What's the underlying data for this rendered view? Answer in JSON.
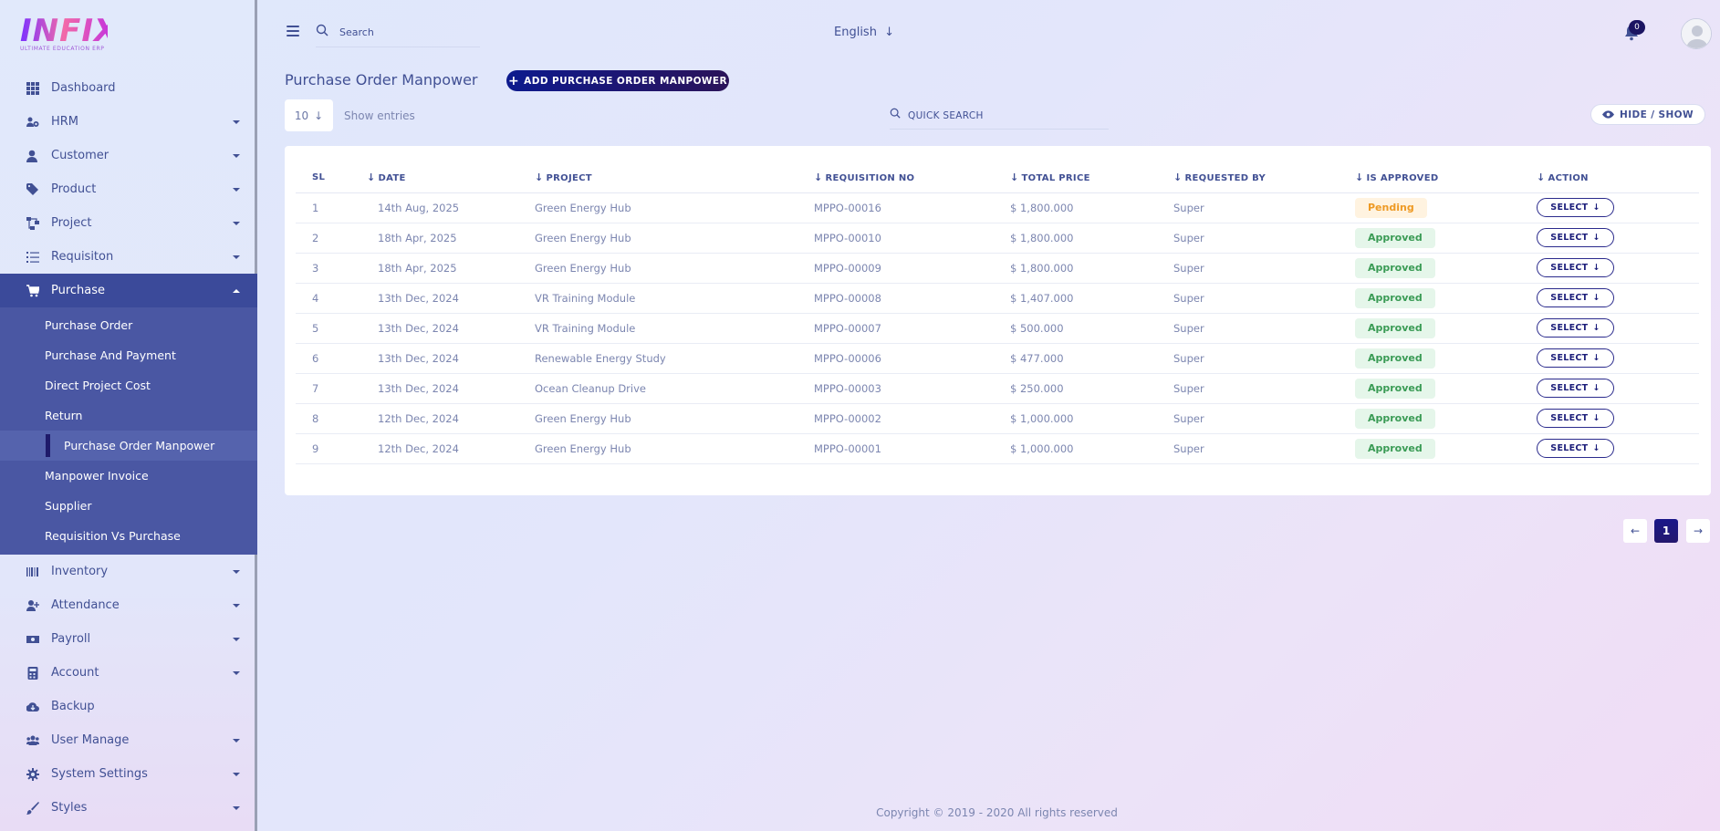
{
  "brand": {
    "logo_text": "INFIX",
    "logo_sub": "ULTIMATE EDUCATION ERP"
  },
  "sidebar": {
    "items": [
      {
        "label": "Dashboard",
        "icon": "dashboard-icon"
      },
      {
        "label": "HRM",
        "icon": "users-cog-icon"
      },
      {
        "label": "Customer",
        "icon": "user-icon"
      },
      {
        "label": "Product",
        "icon": "tags-icon"
      },
      {
        "label": "Project",
        "icon": "project-diagram-icon"
      },
      {
        "label": "Requisiton",
        "icon": "list-icon"
      },
      {
        "label": "Purchase",
        "icon": "cart-icon"
      },
      {
        "label": "Inventory",
        "icon": "barcode-icon"
      },
      {
        "label": "Attendance",
        "icon": "user-plus-icon"
      },
      {
        "label": "Payroll",
        "icon": "money-icon"
      },
      {
        "label": "Account",
        "icon": "calculator-icon"
      },
      {
        "label": "Backup",
        "icon": "cloud-download-icon"
      },
      {
        "label": "User Manage",
        "icon": "users-icon"
      },
      {
        "label": "System Settings",
        "icon": "gear-icon"
      },
      {
        "label": "Styles",
        "icon": "brush-icon"
      }
    ],
    "purchase_submenu": [
      "Purchase Order",
      "Purchase And Payment",
      "Direct Project Cost",
      "Return",
      "Purchase Order Manpower",
      "Manpower Invoice",
      "Supplier",
      "Requisition Vs Purchase"
    ]
  },
  "topbar": {
    "search_placeholder": "Search",
    "language": "English",
    "notification_count": "0"
  },
  "page": {
    "title": "Purchase Order Manpower",
    "add_button": "ADD PURCHASE ORDER MANPOWER",
    "entries_value": "10",
    "entries_label": "Show entries",
    "quick_search_placeholder": "QUICK SEARCH",
    "hide_show": "HIDE / SHOW"
  },
  "table": {
    "headers": [
      "SL",
      "DATE",
      "PROJECT",
      "REQUISITION NO",
      "TOTAL PRICE",
      "REQUESTED BY",
      "IS APPROVED",
      "ACTION"
    ],
    "action_label": "SELECT",
    "rows": [
      {
        "sl": "1",
        "date": "14th Aug, 2025",
        "project": "Green Energy Hub",
        "req": "MPPO-00016",
        "price": "$ 1,800.000",
        "by": "Super",
        "status": "Pending"
      },
      {
        "sl": "2",
        "date": "18th Apr, 2025",
        "project": "Green Energy Hub",
        "req": "MPPO-00010",
        "price": "$ 1,800.000",
        "by": "Super",
        "status": "Approved"
      },
      {
        "sl": "3",
        "date": "18th Apr, 2025",
        "project": "Green Energy Hub",
        "req": "MPPO-00009",
        "price": "$ 1,800.000",
        "by": "Super",
        "status": "Approved"
      },
      {
        "sl": "4",
        "date": "13th Dec, 2024",
        "project": "VR Training Module",
        "req": "MPPO-00008",
        "price": "$ 1,407.000",
        "by": "Super",
        "status": "Approved"
      },
      {
        "sl": "5",
        "date": "13th Dec, 2024",
        "project": "VR Training Module",
        "req": "MPPO-00007",
        "price": "$ 500.000",
        "by": "Super",
        "status": "Approved"
      },
      {
        "sl": "6",
        "date": "13th Dec, 2024",
        "project": "Renewable Energy Study",
        "req": "MPPO-00006",
        "price": "$ 477.000",
        "by": "Super",
        "status": "Approved"
      },
      {
        "sl": "7",
        "date": "13th Dec, 2024",
        "project": "Ocean Cleanup Drive",
        "req": "MPPO-00003",
        "price": "$ 250.000",
        "by": "Super",
        "status": "Approved"
      },
      {
        "sl": "8",
        "date": "12th Dec, 2024",
        "project": "Green Energy Hub",
        "req": "MPPO-00002",
        "price": "$ 1,000.000",
        "by": "Super",
        "status": "Approved"
      },
      {
        "sl": "9",
        "date": "12th Dec, 2024",
        "project": "Green Energy Hub",
        "req": "MPPO-00001",
        "price": "$ 1,000.000",
        "by": "Super",
        "status": "Approved"
      }
    ]
  },
  "pagination": {
    "current": "1"
  },
  "footer": {
    "text": "Copyright © 2019 - 2020 All rights reserved"
  },
  "colors": {
    "primary": "#415094",
    "accent": "#1b1462",
    "approved": "#3a9b55",
    "pending": "#ee9a24"
  }
}
